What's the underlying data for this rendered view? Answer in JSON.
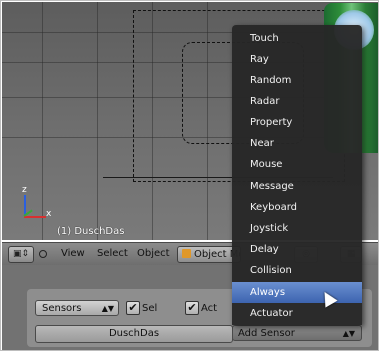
{
  "viewport": {
    "object_label": "(1) DuschDas",
    "axis_z": "z",
    "axis_x": "x"
  },
  "header": {
    "editor_icon": "cube-editor-icon",
    "menus": [
      "View",
      "Select",
      "Object"
    ],
    "mode": "Object Mode"
  },
  "logic": {
    "sensors_select": "Sensors",
    "sel_label": "Sel",
    "act_label": "Act",
    "object_name": "DuschDas",
    "add_sensor": "Add Sensor"
  },
  "dropdown": {
    "items": [
      "Touch",
      "Ray",
      "Random",
      "Radar",
      "Property",
      "Near",
      "Mouse",
      "Message",
      "Keyboard",
      "Joystick",
      "Delay",
      "Collision",
      "Always",
      "Actuator"
    ],
    "highlighted": "Always"
  }
}
